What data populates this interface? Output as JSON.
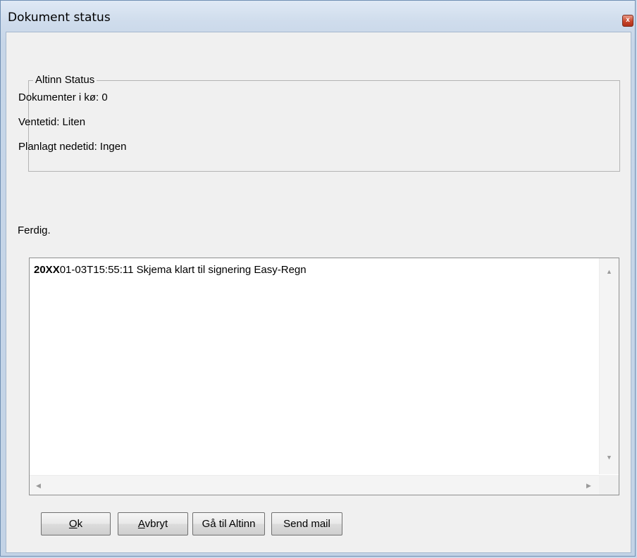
{
  "window": {
    "title": "Dokument status",
    "close_glyph": "x"
  },
  "altinn_status": {
    "legend": "Altinn Status",
    "lines": [
      "Dokumenter i kø: 0",
      "Ventetid: Liten",
      "Planlagt nedetid: Ingen"
    ]
  },
  "status_text": "Ferdig.",
  "log": {
    "entries": [
      {
        "year_prefix": "20XX",
        "rest": "01-03T15:55:11 Skjema klart til signering Easy-Regn"
      }
    ]
  },
  "scrollbar": {
    "up_glyph": "▲",
    "down_glyph": "▼",
    "left_glyph": "◀",
    "right_glyph": "▶"
  },
  "buttons": {
    "ok": {
      "accel": "O",
      "rest": "k"
    },
    "cancel": {
      "accel": "A",
      "rest": "vbryt"
    },
    "goto_altinn": "Gå til Altinn",
    "send_mail": "Send mail"
  }
}
